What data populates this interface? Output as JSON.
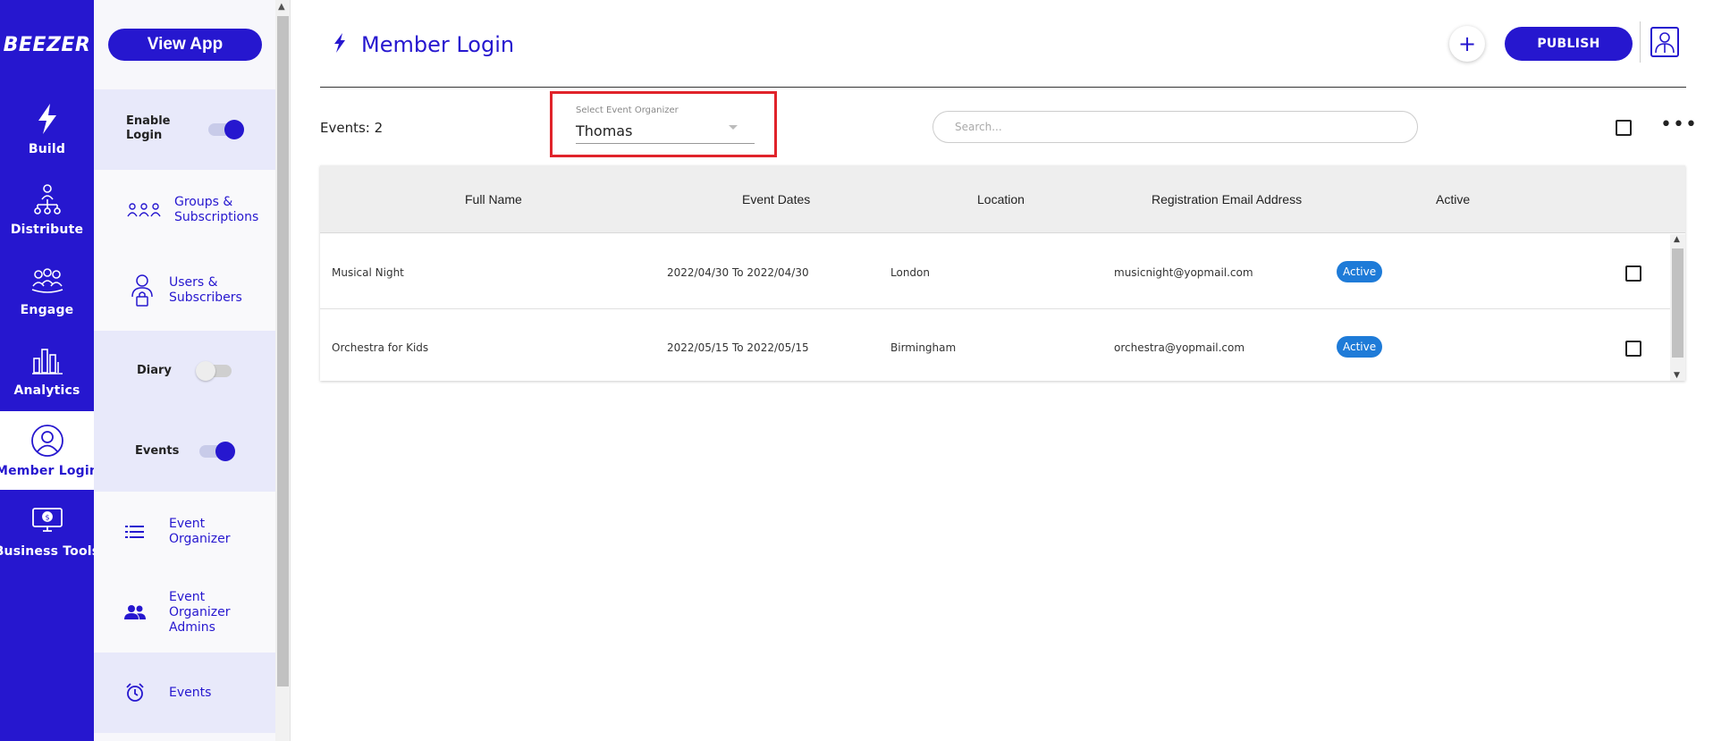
{
  "brand": {
    "name": "BEEZER"
  },
  "nav": {
    "items": [
      {
        "label": "Build",
        "icon": "bolt-icon"
      },
      {
        "label": "Distribute",
        "icon": "distribute-icon"
      },
      {
        "label": "Engage",
        "icon": "engage-icon"
      },
      {
        "label": "Analytics",
        "icon": "analytics-icon"
      },
      {
        "label": "Member Login",
        "icon": "member-login-icon",
        "active": true
      },
      {
        "label": "Business Tools",
        "icon": "business-tools-icon"
      }
    ]
  },
  "sidebar": {
    "view_app": "View App",
    "enable_login": {
      "label": "Enable Login",
      "on": true
    },
    "groups": "Groups & Subscriptions",
    "users": "Users & Subscribers",
    "diary": {
      "label": "Diary",
      "on": false
    },
    "events_toggle": {
      "label": "Events",
      "on": true
    },
    "event_organizer": "Event Organizer",
    "event_organizer_admins": "Event Organizer Admins",
    "events": "Events"
  },
  "header": {
    "title": "Member Login",
    "publish": "PUBLISH",
    "plus": "+"
  },
  "toolbar": {
    "events_count": "Events: 2",
    "select_label": "Select Event Organizer",
    "select_value": "Thomas",
    "search_placeholder": "Search..."
  },
  "table": {
    "columns": [
      "Full Name",
      "Event Dates",
      "Location",
      "Registration Email Address",
      "Active"
    ],
    "rows": [
      {
        "name": "Musical Night",
        "dates": "2022/04/30 To 2022/04/30",
        "location": "London",
        "email": "musicnight@yopmail.com",
        "status": "Active"
      },
      {
        "name": "Orchestra for Kids",
        "dates": "2022/05/15 To 2022/05/15",
        "location": "Birmingham",
        "email": "orchestra@yopmail.com",
        "status": "Active"
      }
    ]
  },
  "colors": {
    "brand": "#2617cf",
    "badge": "#1e7bd8",
    "highlight": "#e0232a"
  }
}
